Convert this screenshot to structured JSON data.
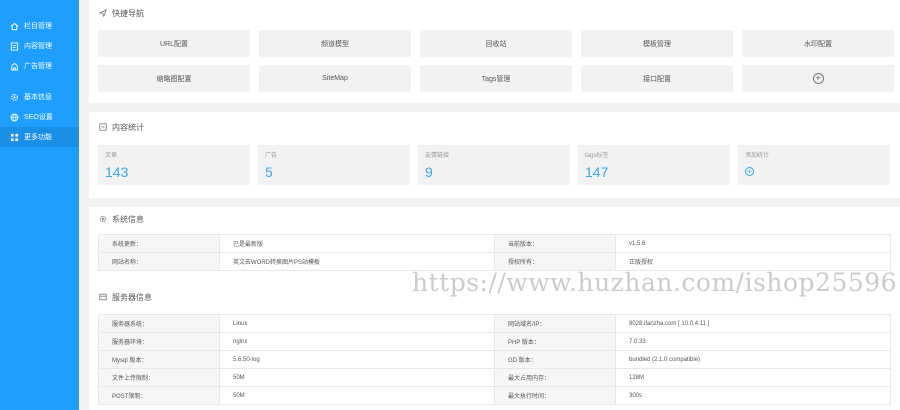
{
  "sidebar": {
    "items": [
      {
        "label": "栏目管理",
        "icon": "home-icon"
      },
      {
        "label": "内容管理",
        "icon": "document-icon"
      },
      {
        "label": "广告管理",
        "icon": "building-icon"
      },
      {
        "label": "基本信息",
        "icon": "settings-icon"
      },
      {
        "label": "SEO设置",
        "icon": "globe-icon"
      },
      {
        "label": "更多功能",
        "icon": "grid-icon"
      }
    ],
    "active_index": 5
  },
  "quick_nav": {
    "title": "快捷导航",
    "buttons": [
      "URL配置",
      "频道模型",
      "回收站",
      "模板管理",
      "水印配置",
      "缩略图配置",
      "SiteMap",
      "Tags管理",
      "接口配置"
    ],
    "add_icon": "plus-circle-icon"
  },
  "content_stats": {
    "title": "内容统计",
    "items": [
      {
        "label": "文章",
        "value": "143"
      },
      {
        "label": "广告",
        "value": "5"
      },
      {
        "label": "友情链接",
        "value": "9"
      },
      {
        "label": "tags标签",
        "value": "147"
      },
      {
        "label": "添加统计",
        "value": ""
      }
    ]
  },
  "system_info": {
    "title": "系统信息",
    "rows": [
      [
        "系统更新：",
        "已是最新版",
        "当前版本：",
        "v1.5.6"
      ],
      [
        "网站名称：",
        "英文去WORD转换图片PS站模板",
        "授权所有：",
        "正版授权"
      ]
    ]
  },
  "server_info": {
    "title": "服务器信息",
    "rows": [
      [
        "服务器系统：",
        "Linux",
        "网站域名/IP：",
        "8028.ifanzha.com [ 10.0.4.11 ]"
      ],
      [
        "服务器环境：",
        "nginx",
        "PHP 版本：",
        "7.0.33"
      ],
      [
        "Mysql 版本：",
        "5.6.50-log",
        "GD 版本：",
        "bundled (2.1.0 compatible)"
      ],
      [
        "文件上传限制：",
        "50M",
        "最大占用内存：",
        "128M"
      ],
      [
        "POST限制：",
        "50M",
        "最大执行时间：",
        "300s"
      ]
    ]
  },
  "watermark": "https://www.huzhan.com/ishop25596",
  "colors": {
    "sidebar_bg": "#1e9fff",
    "sidebar_active": "#1a8fe6",
    "stat_value": "#3aa7e6"
  }
}
